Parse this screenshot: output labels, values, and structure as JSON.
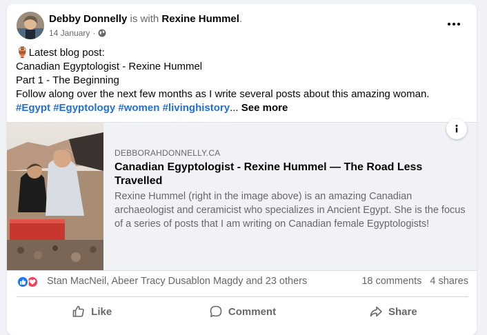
{
  "post": {
    "author": "Debby Donnelly",
    "with_text": "is with",
    "tagged": "Rexine Hummel",
    "period": ".",
    "date": "14 January",
    "separator": "·",
    "privacy_icon": "globe-icon",
    "body": {
      "emoji": "🏺",
      "line1": "Latest blog post:",
      "line2": "Canadian Egyptologist - Rexine Hummel",
      "line3": "Part 1 - The Beginning",
      "line4": "Follow along over the next few months as I write several posts about this amazing woman.",
      "hashtags": [
        "#Egypt",
        "#Egyptology",
        "#women",
        "#livinghistory"
      ],
      "ellipsis": "...",
      "see_more": "See more"
    }
  },
  "link_preview": {
    "domain": "DEBBORAHDONNELLY.CA",
    "title": "Canadian Egyptologist - Rexine Hummel — The Road Less Travelled",
    "description": "Rexine Hummel (right in the image above) is an amazing Canadian archaeologist and ceramicist who specializes in Ancient Egypt. She is the focus of a series of posts that I am writing on Canadian female Egyptologists!",
    "info_icon": "info-icon"
  },
  "stats": {
    "reactors": "Stan MacNeil, Abeer Tracy Dusablon Magdy and 23 others",
    "comments": "18 comments",
    "shares": "4 shares"
  },
  "actions": {
    "like": "Like",
    "comment": "Comment",
    "share": "Share"
  },
  "colors": {
    "link_blue": "#216fdb",
    "like_blue": "#1877f2",
    "love_red": "#f33e58",
    "secondary_text": "#65676b"
  }
}
